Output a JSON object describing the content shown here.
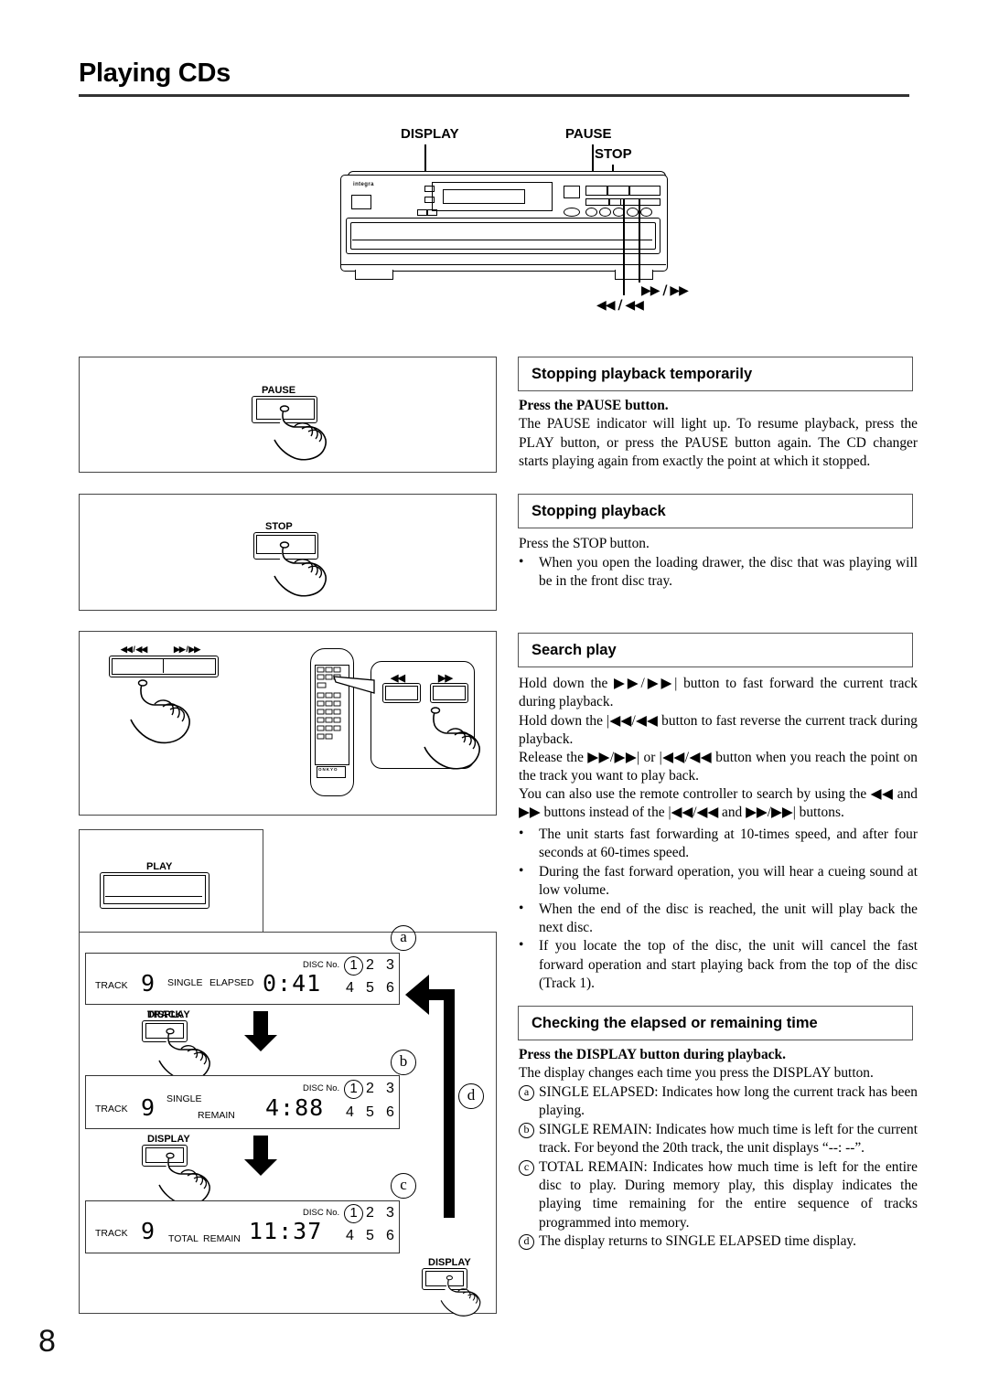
{
  "page": {
    "title": "Playing CDs",
    "number": "8"
  },
  "device_diagram": {
    "brand": "integra",
    "callouts": {
      "display": "DISPLAY",
      "pause": "PAUSE",
      "stop": "STOP",
      "skip_back": "◀◀ / ◀◀",
      "skip_fwd": "▶▶ / ▶▶"
    }
  },
  "illustrations": {
    "pause_panel": {
      "button_label": "PAUSE"
    },
    "stop_panel": {
      "button_label": "STOP"
    },
    "search_panel": {
      "unit_left_label": "◀◀ / ◀◀",
      "unit_right_label": "▶▶ / ▶▶",
      "remote_brand": "ONKYO",
      "remote_left_label": "◀◀",
      "remote_right_label": "▶▶"
    },
    "play_panel": {
      "button_label": "PLAY"
    },
    "display_button_label": "DISPLAY",
    "display_sequence": {
      "step_a_tag": "a",
      "step_b_tag": "b",
      "step_c_tag": "c",
      "step_d_tag": "d",
      "panels": [
        {
          "tag": "a",
          "track_label": "TRACK",
          "track_value": "9",
          "mode1": "SINGLE",
          "mode2": "ELAPSED",
          "time": "0:41",
          "disc_label": "DISC No.",
          "discs_row1": [
            "1",
            "2",
            "3"
          ],
          "discs_row2": [
            "4",
            "5",
            "6"
          ],
          "selected_disc": "1"
        },
        {
          "tag": "b",
          "track_label": "TRACK",
          "track_value": "9",
          "mode1": "SINGLE",
          "mode2": "REMAIN",
          "time": "4:88",
          "disc_label": "DISC No.",
          "discs_row1": [
            "1",
            "2",
            "3"
          ],
          "discs_row2": [
            "4",
            "5",
            "6"
          ],
          "selected_disc": "1"
        },
        {
          "tag": "c",
          "track_label": "TRACK",
          "track_value": "9",
          "mode1": "TOTAL",
          "mode2": "REMAIN",
          "time": "11:37",
          "disc_label": "DISC No.",
          "discs_row1": [
            "1",
            "2",
            "3"
          ],
          "discs_row2": [
            "4",
            "5",
            "6"
          ],
          "selected_disc": "1"
        }
      ]
    }
  },
  "sections": [
    {
      "id": "stopping-temporarily",
      "heading": "Stopping playback temporarily",
      "lead_bold": "Press the PAUSE button.",
      "body": "The PAUSE indicator will light up. To resume playback, press the PLAY button, or press the PAUSE button again. The CD changer starts playing again from exactly the point at which it stopped."
    },
    {
      "id": "stopping-playback",
      "heading": "Stopping playback",
      "body": "Press the STOP button.",
      "bullets": [
        "When you open the loading drawer, the disc that was playing will be in the front disc tray."
      ]
    },
    {
      "id": "search-play",
      "heading": "Search play",
      "paragraphs": [
        "Hold down the ▶▶/▶▶| button to fast forward the current track during playback.",
        "Hold down the |◀◀/◀◀ button to fast reverse the current track during playback.",
        "Release the ▶▶/▶▶| or |◀◀/◀◀ button when you reach the point on the track you want to play back.",
        "You can also use the remote controller to search by using the ◀◀ and ▶▶ buttons instead of the |◀◀/◀◀ and ▶▶/▶▶| buttons."
      ],
      "bullets": [
        "The unit starts fast forwarding at 10-times speed, and after four seconds at 60-times speed.",
        "During the fast forward operation, you will hear a cueing sound at low volume.",
        "When the end of the disc is reached, the unit will play back the next disc.",
        "If you locate the top of the disc, the unit will cancel the fast forward operation and start playing back from the top of the disc (Track 1)."
      ]
    },
    {
      "id": "checking-time",
      "heading": "Checking the elapsed or remaining time",
      "lead_bold": "Press the DISPLAY button during playback.",
      "body": "The display changes each time you press the DISPLAY button.",
      "items": [
        {
          "mark": "a",
          "text": "SINGLE ELAPSED: Indicates how long the current track has been playing."
        },
        {
          "mark": "b",
          "text": "SINGLE REMAIN: Indicates how much time is left for the current track. For beyond the 20th track, the unit displays “--: --”."
        },
        {
          "mark": "c",
          "text": "TOTAL REMAIN: Indicates how much time is left for the entire disc to play. During memory play, this display indicates the playing time remaining for the entire sequence of tracks programmed into memory."
        },
        {
          "mark": "d",
          "text": "The display returns to SINGLE ELAPSED time display."
        }
      ]
    }
  ]
}
